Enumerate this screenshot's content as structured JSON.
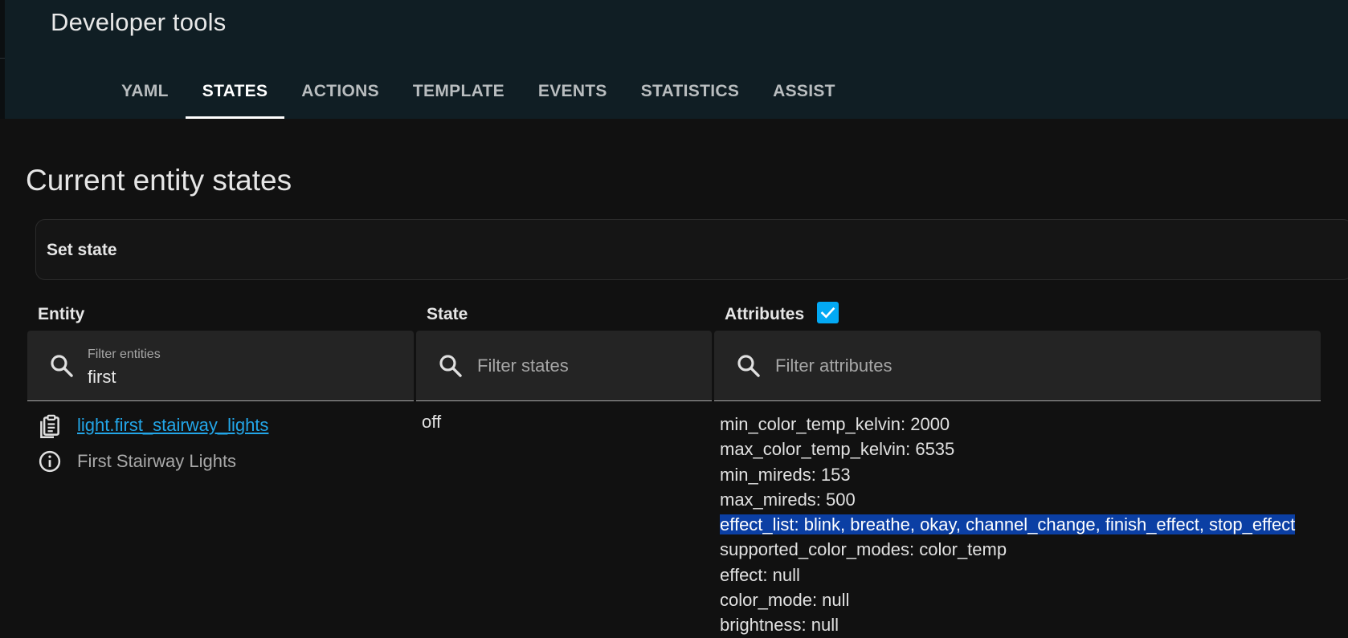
{
  "header": {
    "title": "Developer tools",
    "tabs": [
      {
        "label": "YAML",
        "active": false
      },
      {
        "label": "STATES",
        "active": true
      },
      {
        "label": "ACTIONS",
        "active": false
      },
      {
        "label": "TEMPLATE",
        "active": false
      },
      {
        "label": "EVENTS",
        "active": false
      },
      {
        "label": "STATISTICS",
        "active": false
      },
      {
        "label": "ASSIST",
        "active": false
      }
    ]
  },
  "page": {
    "title": "Current entity states",
    "set_state_label": "Set state"
  },
  "columns": {
    "entity": "Entity",
    "state": "State",
    "attributes": "Attributes",
    "attributes_checked": true
  },
  "filters": {
    "entity_label": "Filter entities",
    "entity_value": "first",
    "state_placeholder": "Filter states",
    "attributes_placeholder": "Filter attributes"
  },
  "row": {
    "entity_id": "light.first_stairway_lights",
    "friendly_name": "First Stairway Lights",
    "state": "off",
    "attributes": [
      "min_color_temp_kelvin: 2000",
      "max_color_temp_kelvin: 6535",
      "min_mireds: 153",
      "max_mireds: 500",
      "effect_list: blink, breathe, okay, channel_change, finish_effect, stop_effect",
      "supported_color_modes: color_temp",
      "effect: null",
      "color_mode: null",
      "brightness: null"
    ],
    "selected_attribute_index": 4
  },
  "icons": {
    "search": "search-icon",
    "clipboard": "clipboard-icon",
    "info": "info-icon",
    "check": "check-icon"
  },
  "colors": {
    "accent": "#03a9f4",
    "link": "#23a6e8",
    "selection": "#0b3fa4",
    "header_bg": "#101e24",
    "page_bg": "#111111"
  }
}
